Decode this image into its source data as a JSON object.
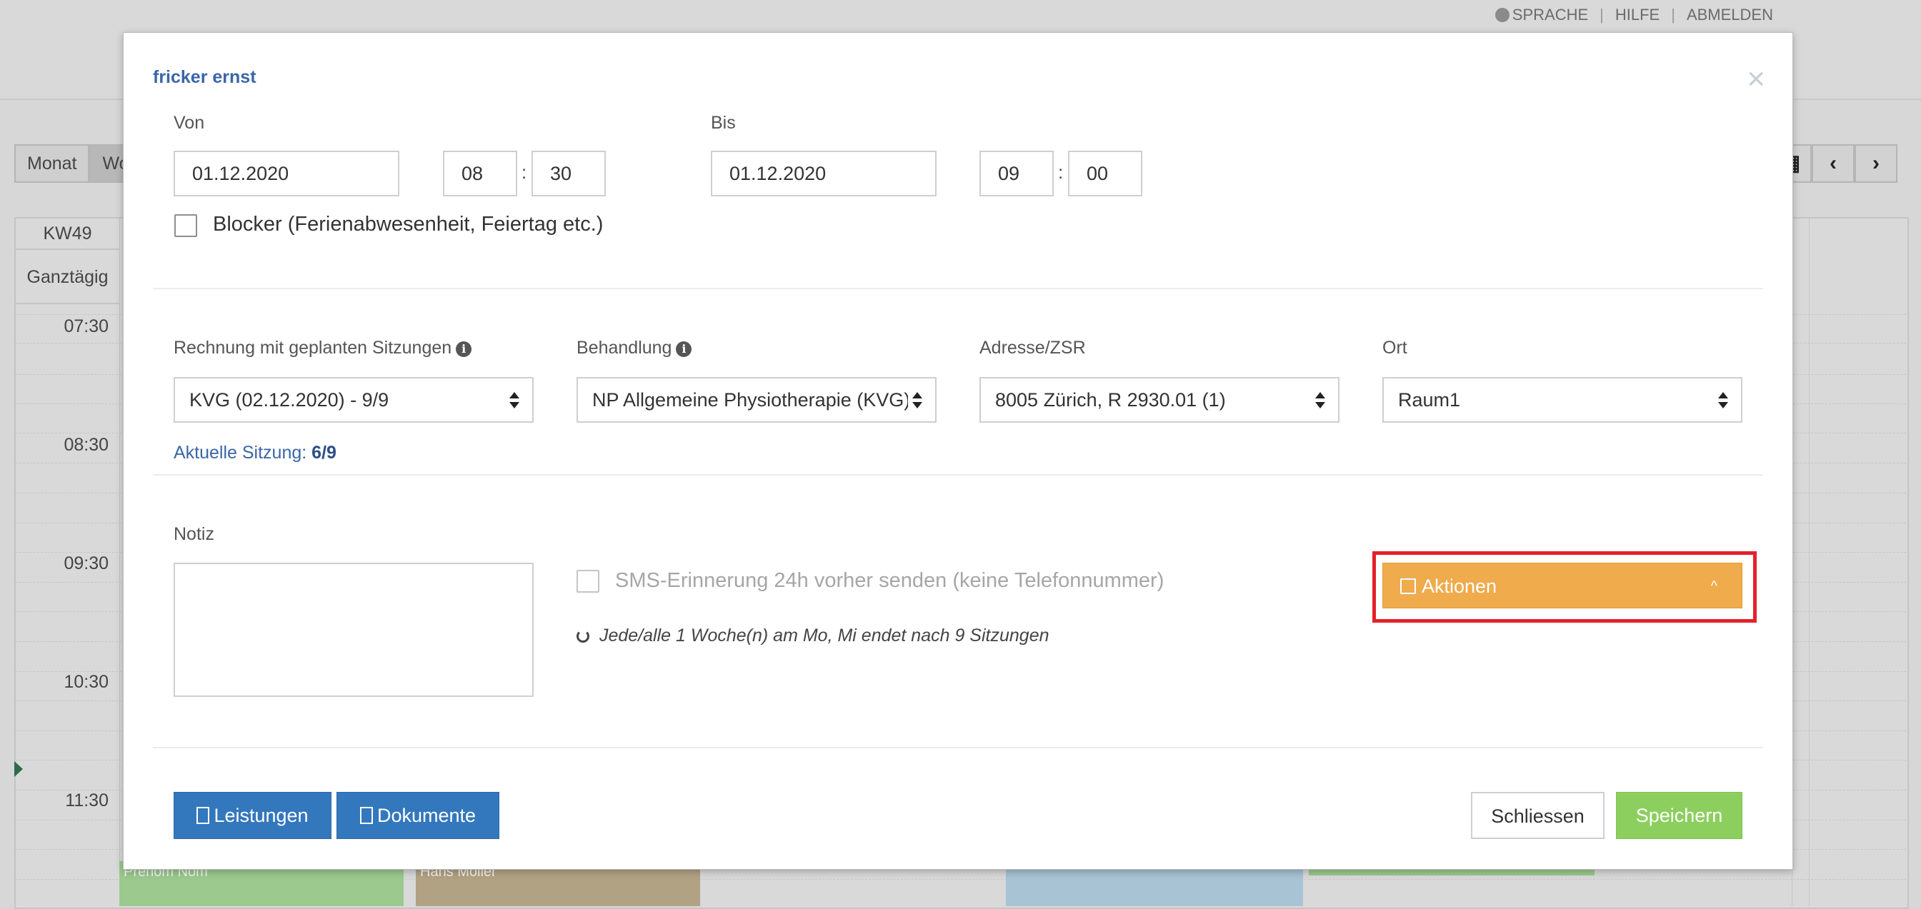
{
  "header": {
    "links": [
      "SPRACHE",
      "HILFE",
      "ABMELDEN"
    ]
  },
  "calendar": {
    "views": [
      "Monat",
      "Wo"
    ],
    "week_label": "KW49",
    "allday_label": "Ganztägig",
    "hours": [
      "07:30",
      "08:30",
      "09:30",
      "10:30",
      "11:30"
    ],
    "events": [
      "Prenom Nom",
      "Hans Möller"
    ]
  },
  "modal": {
    "title": "fricker ernst",
    "close_icon": "×",
    "from": {
      "label": "Von",
      "date": "01.12.2020",
      "hour": "08",
      "minute": "30"
    },
    "to": {
      "label": "Bis",
      "date": "01.12.2020",
      "hour": "09",
      "minute": "00"
    },
    "time_separator": ":",
    "blocker_label": "Blocker (Ferienabwesenheit, Feiertag etc.)",
    "billing": {
      "label": "Rechnung mit geplanten Sitzungen",
      "value": "KVG (02.12.2020) - 9/9"
    },
    "treatment": {
      "label": "Behandlung",
      "value": "NP Allgemeine Physiotherapie (KVG)"
    },
    "address": {
      "label": "Adresse/ZSR",
      "value": "8005 Zürich, R 2930.01 (1)"
    },
    "location": {
      "label": "Ort",
      "value": "Raum1"
    },
    "session": {
      "label": "Aktuelle Sitzung:",
      "value": "6/9"
    },
    "note_label": "Notiz",
    "sms_label": "SMS-Erinnerung 24h vorher senden (keine Telefonnummer)",
    "repeat_text": "Jede/alle 1 Woche(n) am Mo, Mi endet nach 9 Sitzungen",
    "actions_label": "Aktionen",
    "buttons": {
      "services": "Leistungen",
      "documents": "Dokumente",
      "close": "Schliessen",
      "save": "Speichern"
    }
  },
  "colors": {
    "accent_blue": "#3377bd",
    "actions_orange": "#efab4c",
    "save_green": "#8ccf5e",
    "highlight_red": "#e2222b",
    "title_blue": "#3a66a8"
  }
}
